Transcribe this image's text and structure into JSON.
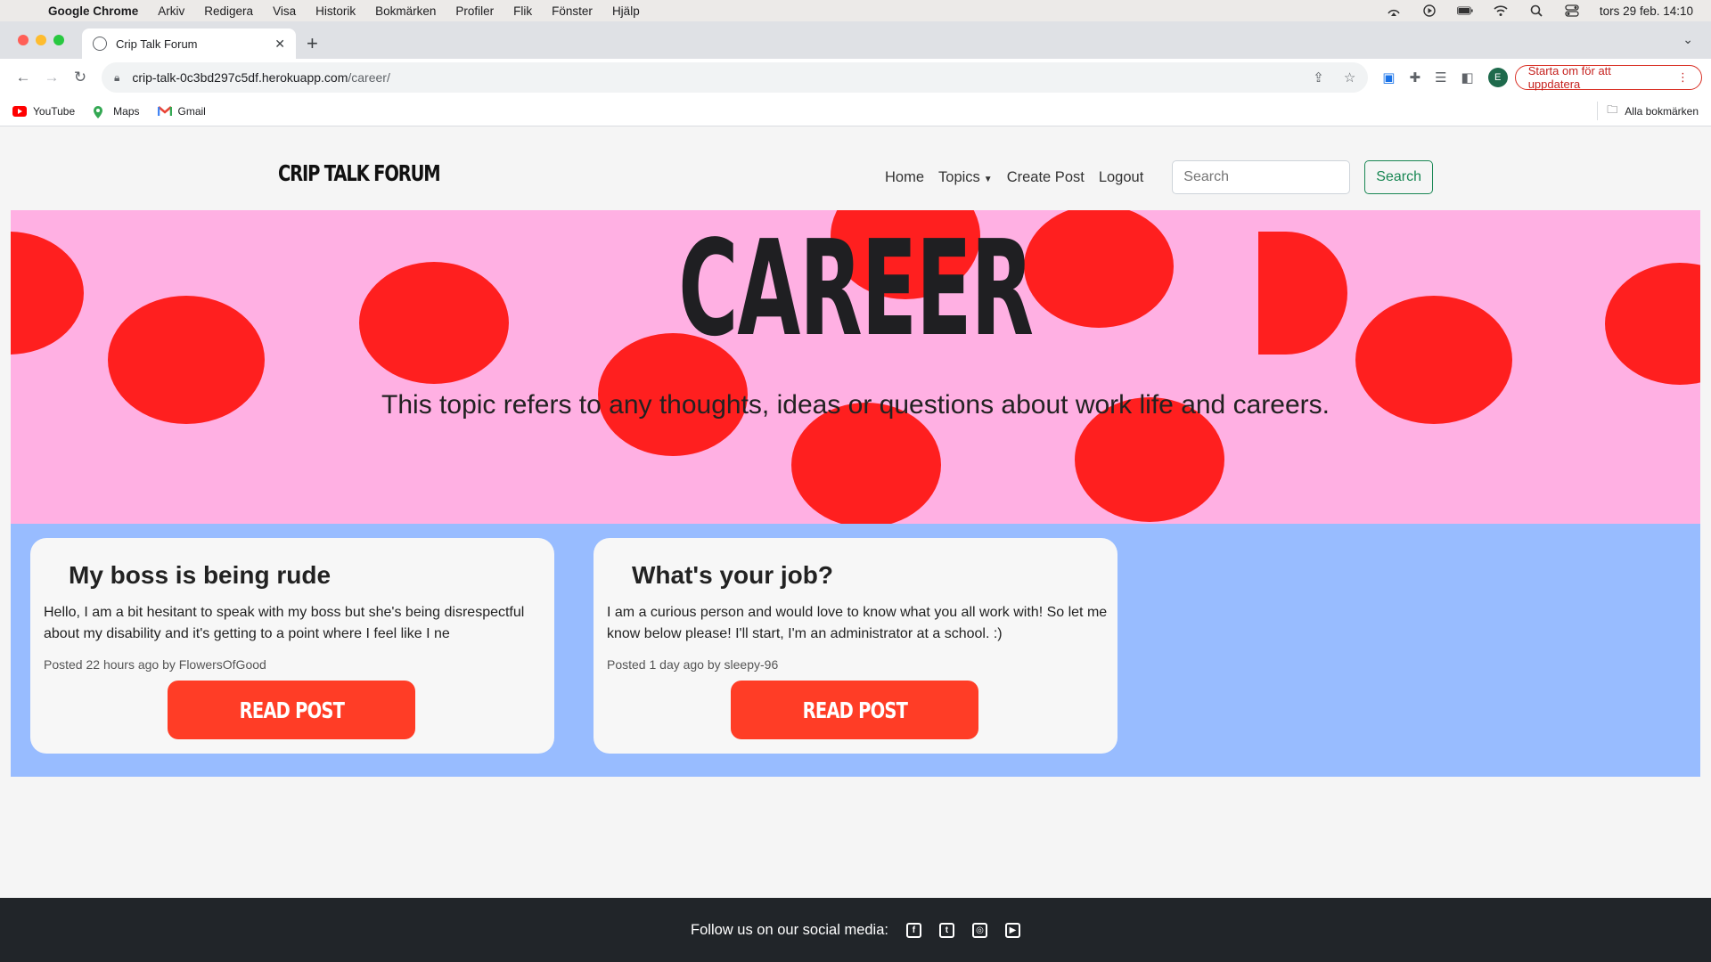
{
  "menubar": {
    "app": "Google Chrome",
    "items": [
      "Arkiv",
      "Redigera",
      "Visa",
      "Historik",
      "Bokmärken",
      "Profiler",
      "Flik",
      "Fönster",
      "Hjälp"
    ],
    "clock": "tors 29 feb. 14:10"
  },
  "browser": {
    "tab_title": "Crip Talk Forum",
    "url_host": "crip-talk-0c3bd297c5df.herokuapp.com",
    "url_path": "/career/",
    "profile_initial": "E",
    "update_label": "Starta om för att uppdatera",
    "bookmarks": [
      "YouTube",
      "Maps",
      "Gmail"
    ],
    "all_bookmarks": "Alla bokmärken"
  },
  "nav": {
    "brand": "CRIP TALK FORUM",
    "links": [
      "Home",
      "Topics",
      "Create Post",
      "Logout"
    ],
    "search_placeholder": "Search",
    "search_button": "Search"
  },
  "hero": {
    "title": "CAREER",
    "description": "This topic refers to any thoughts, ideas or questions about work life and careers."
  },
  "posts": [
    {
      "title": "My boss is being rude",
      "excerpt": "Hello, I am a bit hesitant to speak with my boss but she's being disrespectful about my disability and it's getting to a point where I feel like I ne",
      "meta": "Posted 22 hours ago by FlowersOfGood",
      "button": "READ POST"
    },
    {
      "title": "What's your job?",
      "excerpt": "I am a curious person and would love to know what you all work with! So let me know below please! I'll start, I'm an administrator at a school. :)",
      "meta": "Posted 1 day ago by sleepy-96",
      "button": "READ POST"
    }
  ],
  "footer": {
    "text": "Follow us on our social media:",
    "icons": [
      "facebook-icon",
      "twitter-icon",
      "instagram-icon",
      "youtube-icon"
    ]
  },
  "colors": {
    "hero_bg": "#ffb0e3",
    "dots": "#ff1f1f",
    "posts_bg": "#98bcff",
    "button": "#ff3d26",
    "footer": "#212529",
    "search_green": "#198754"
  }
}
